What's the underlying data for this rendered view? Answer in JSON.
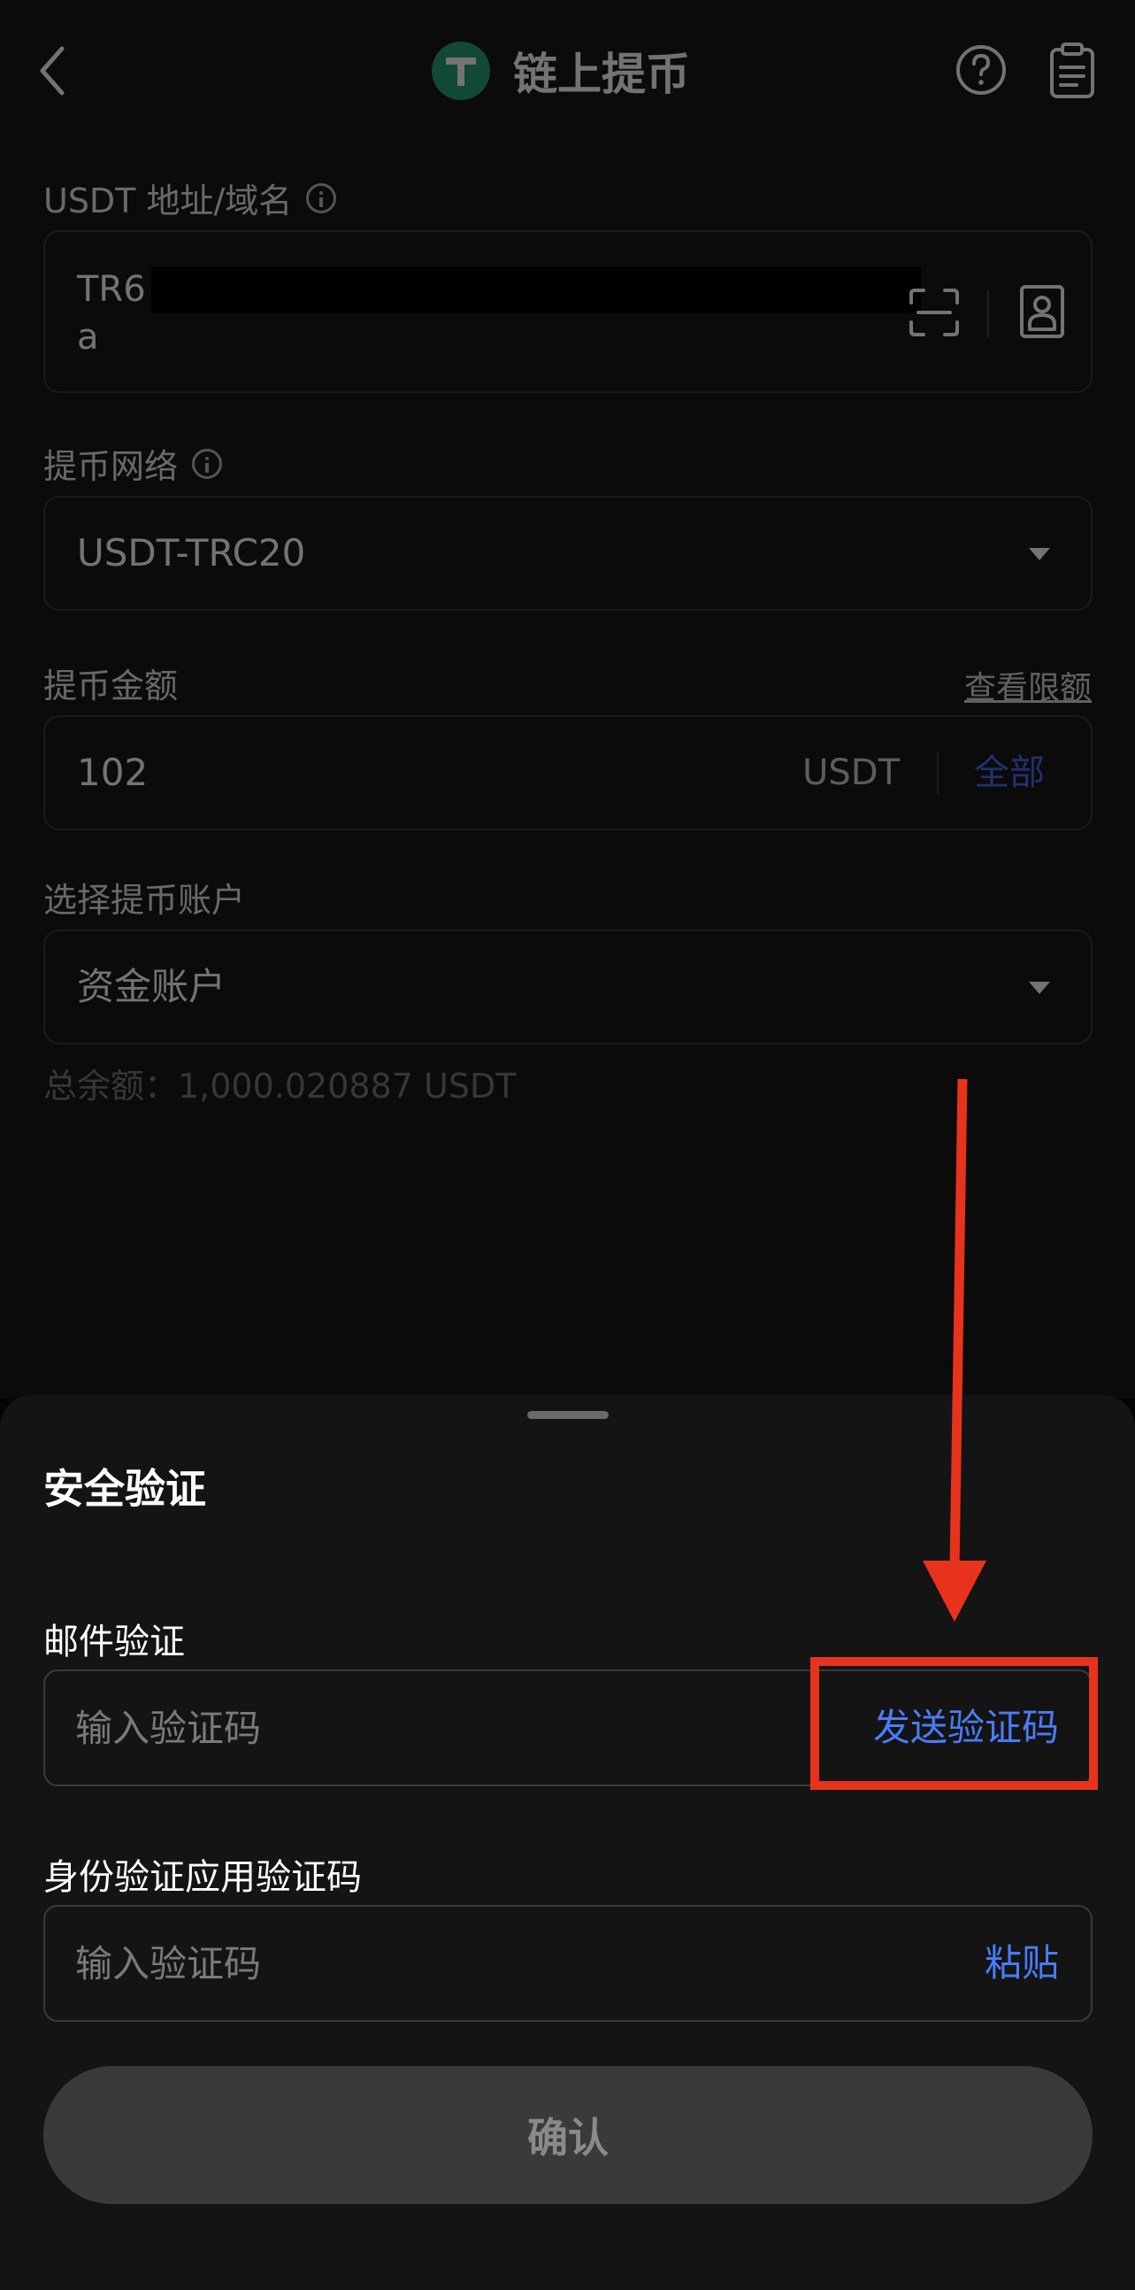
{
  "header": {
    "title": "链上提币",
    "coin_icon": "tether-logo-icon",
    "back_icon": "back-chevron-icon",
    "help_icon": "help-circle-icon",
    "records_icon": "clipboard-icon"
  },
  "address": {
    "label": "USDT 地址/域名",
    "value_line1": "TR6",
    "value_line2": "a",
    "scan_icon": "scan-icon",
    "contacts_icon": "address-book-icon"
  },
  "network": {
    "label": "提币网络",
    "value": "USDT-TRC20"
  },
  "amount": {
    "label": "提币金额",
    "limit_link": "查看限额",
    "value": "102",
    "unit": "USDT",
    "all_label": "全部"
  },
  "account": {
    "label": "选择提币账户",
    "value": "资金账户",
    "balance": "总余额：1,000.020887 USDT"
  },
  "verify_sheet": {
    "title": "安全验证",
    "email": {
      "label": "邮件验证",
      "placeholder": "输入验证码",
      "send_code": "发送验证码"
    },
    "authenticator": {
      "label": "身份验证应用验证码",
      "placeholder": "输入验证码",
      "paste": "粘贴"
    },
    "confirm_label": "确认"
  },
  "colors": {
    "accent_blue": "#4a7cf7",
    "annotation_red": "#e8331c",
    "tether_green": "#26a17b"
  }
}
